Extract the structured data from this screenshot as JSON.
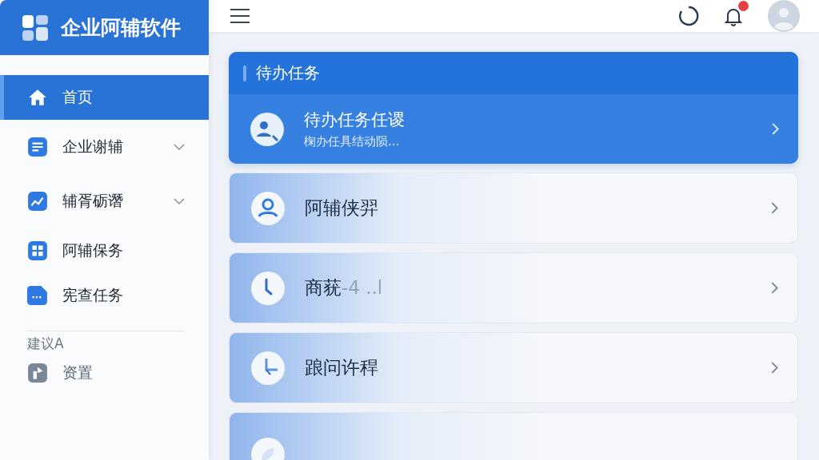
{
  "app": {
    "title": "企业阿辅软件"
  },
  "nav": [
    {
      "label": "首页",
      "kind": "link",
      "selected": true
    },
    {
      "label": "企业谢辅",
      "kind": "group",
      "selected": false
    },
    {
      "label": "辅胥砺谮",
      "kind": "group",
      "selected": false
    },
    {
      "label": "阿辅保务",
      "kind": "link",
      "selected": false
    },
    {
      "label": "宪查任务",
      "kind": "link",
      "selected": false
    }
  ],
  "section": {
    "title": "建议A",
    "items": [
      {
        "label": "资置",
        "selected": false
      }
    ]
  },
  "topbar": {
    "notifications_unread": true
  },
  "todo": {
    "title": "待办任务",
    "item": {
      "title": "待办任务任谡",
      "subtitle": "椈办任具结动陨..."
    }
  },
  "cards": [
    {
      "kind": "entry",
      "title": "阿辅侠羿"
    },
    {
      "kind": "entry",
      "title": "商莸",
      "suffix": "-4 ..l"
    },
    {
      "kind": "entry",
      "title": "踉问许稈"
    },
    {
      "kind": "cut-off"
    }
  ]
}
